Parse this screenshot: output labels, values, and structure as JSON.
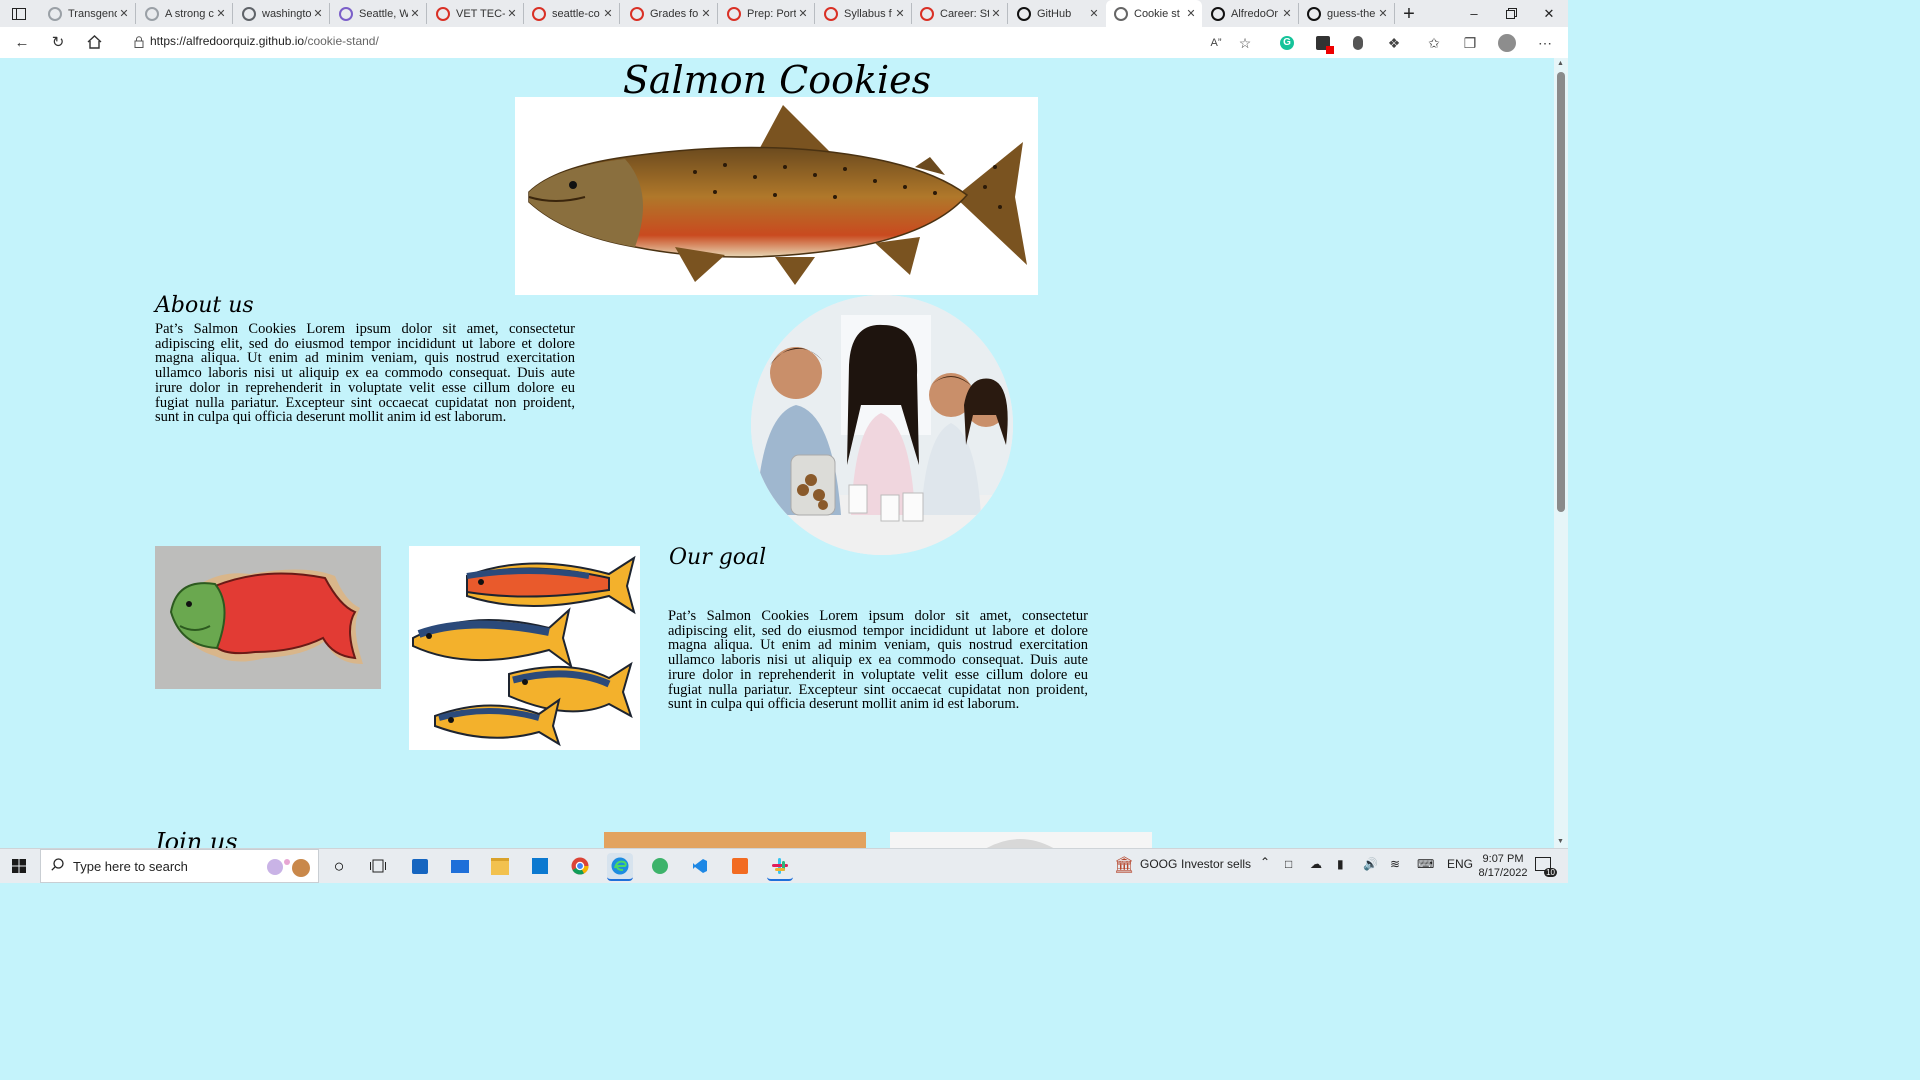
{
  "browser": {
    "tabs": [
      {
        "title": "Transgend",
        "favicon_color": "#9aa0a6"
      },
      {
        "title": "A strong c",
        "favicon_color": "#9aa0a6"
      },
      {
        "title": "washingto",
        "favicon_color": "#5f6368"
      },
      {
        "title": "Seattle, W",
        "favicon_color": "#7b5fc9"
      },
      {
        "title": "VET TEC-C",
        "favicon_color": "#d93025"
      },
      {
        "title": "seattle-co",
        "favicon_color": "#d93025"
      },
      {
        "title": "Grades fo",
        "favicon_color": "#d93025"
      },
      {
        "title": "Prep: Port",
        "favicon_color": "#d93025"
      },
      {
        "title": "Syllabus f",
        "favicon_color": "#d93025"
      },
      {
        "title": "Career: St",
        "favicon_color": "#d93025"
      },
      {
        "title": "GitHub",
        "favicon_color": "#111111"
      },
      {
        "title": "Cookie st",
        "favicon_color": "#666666"
      },
      {
        "title": "AlfredoOr",
        "favicon_color": "#111111"
      },
      {
        "title": "guess-the",
        "favicon_color": "#111111"
      }
    ],
    "active_tab_index": 11,
    "url_host": "https://alfredoorquiz.github.io",
    "url_path": "/cookie-stand/"
  },
  "page": {
    "title": "Salmon Cookies",
    "about_heading": "About us",
    "about_text": "Pat’s Salmon Cookies Lorem ipsum dolor sit amet, consectetur adipiscing elit, sed do eiusmod tempor incididunt ut labore et dolore magna aliqua. Ut enim ad minim veniam, quis nostrud exercitation ullamco laboris nisi ut aliquip ex ea commodo consequat. Duis aute irure dolor in reprehenderit in voluptate velit esse cillum dolore eu fugiat nulla pariatur. Excepteur sint occaecat cupidatat non proident, sunt in culpa qui officia deserunt mollit anim id est laborum.",
    "goal_heading": "Our goal",
    "goal_text": "Pat’s Salmon Cookies Lorem ipsum dolor sit amet, consectetur adipiscing elit, sed do eiusmod tempor incididunt ut labore et dolore magna aliqua. Ut enim ad minim veniam, quis nostrud exercitation ullamco laboris nisi ut aliquip ex ea commodo consequat. Duis aute irure dolor in reprehenderit in voluptate velit esse cillum dolore eu fugiat nulla pariatur. Excepteur sint occaecat cupidatat non proident, sunt in culpa qui officia deserunt mollit anim id est laborum.",
    "join_heading": "Join us",
    "background_color": "#c4f3fb"
  },
  "taskbar": {
    "search_placeholder": "Type here to search",
    "stock_ticker": "GOOG",
    "stock_text": "Investor sells",
    "language": "ENG",
    "time": "9:07 PM",
    "date": "8/17/2022",
    "notification_count": "10"
  }
}
